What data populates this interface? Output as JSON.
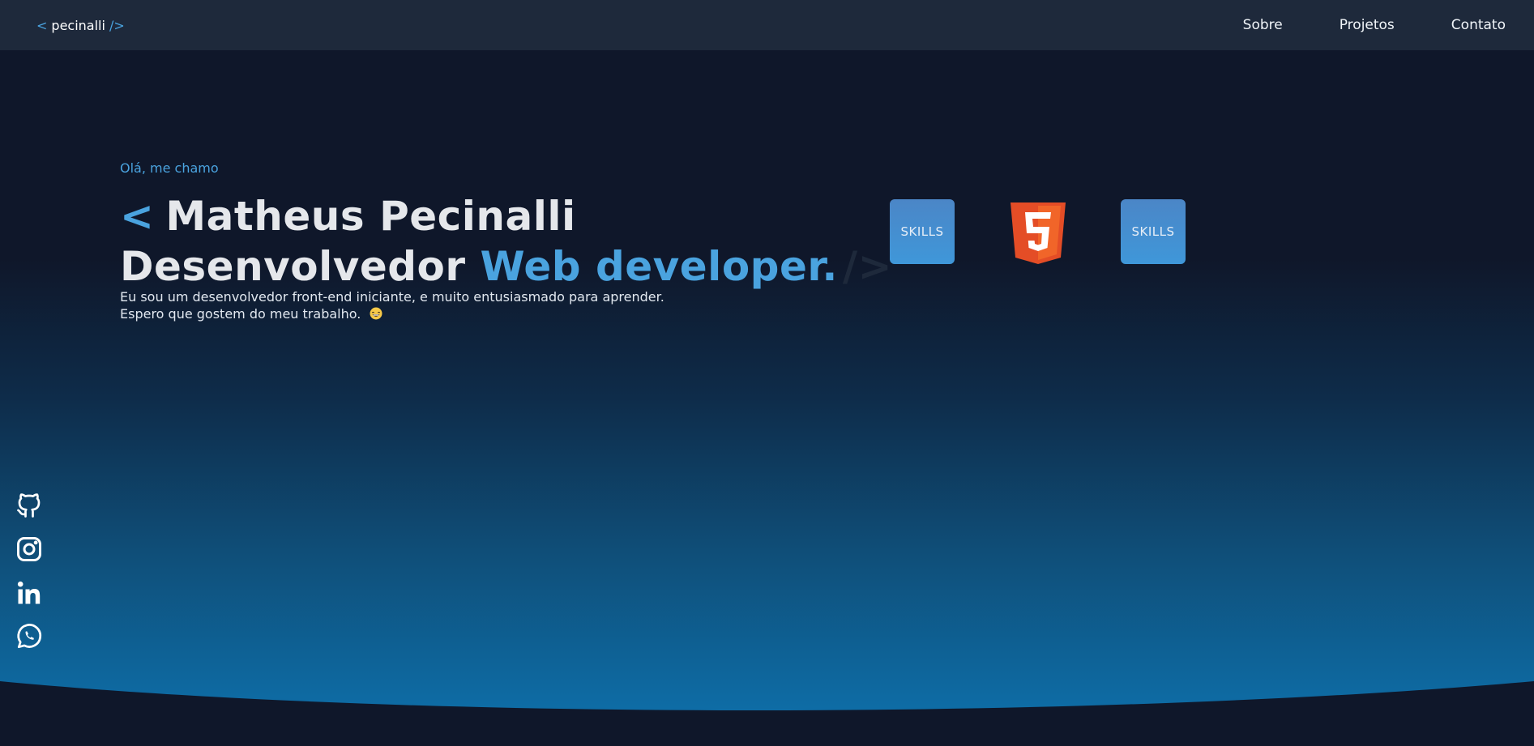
{
  "header": {
    "logo": {
      "open_bracket": "<",
      "text": "pecinalli",
      "close_bracket": "/>"
    },
    "nav": [
      {
        "label": "Sobre"
      },
      {
        "label": "Projetos"
      },
      {
        "label": "Contato"
      }
    ]
  },
  "hero": {
    "greeting": "Olá, me chamo",
    "title_prefix": "<",
    "name": "Matheus Pecinalli",
    "role_prefix": "Desenvolvedor",
    "role_accent": "Web developer.",
    "title_suffix": "/>",
    "description_line1": "Eu sou um desenvolvedor front-end iniciante, e muito entusiasmado para aprender.",
    "description_line2": "Espero que gostem do meu trabalho.",
    "description_emoji": "grinning-face-icon"
  },
  "skills": [
    {
      "label": "SKILLS"
    },
    {
      "label": "",
      "icon": "html5-icon"
    },
    {
      "label": "SKILLS"
    }
  ],
  "social": [
    {
      "icon": "github-icon"
    },
    {
      "icon": "instagram-icon"
    },
    {
      "icon": "linkedin-icon"
    },
    {
      "icon": "whatsapp-icon"
    }
  ],
  "colors": {
    "accent": "#4aa3df",
    "background": "#0f172a",
    "header": "#1e293b",
    "html5_orange": "#e44d26"
  }
}
